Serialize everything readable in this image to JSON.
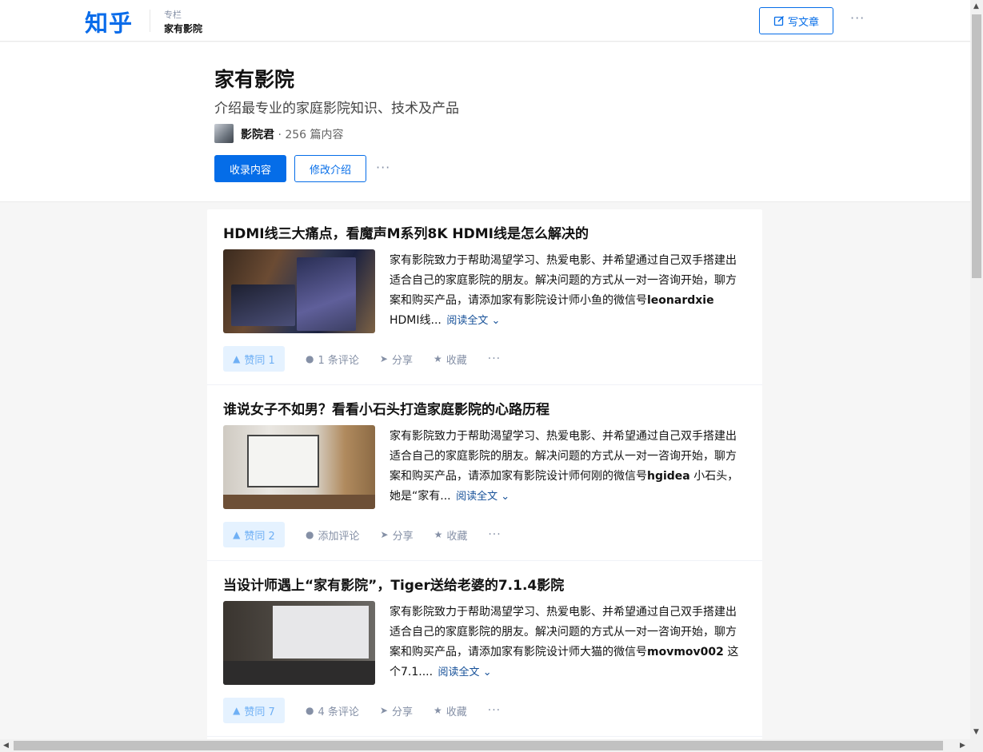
{
  "header": {
    "logo": "知乎",
    "crumb_small": "专栏",
    "crumb_title": "家有影院",
    "write_label": "写文章",
    "more": "···"
  },
  "column": {
    "title": "家有影院",
    "description": "介绍最专业的家庭影院知识、技术及产品",
    "author": "影院君",
    "count_text": " · 256 篇内容",
    "collect_label": "收录内容",
    "edit_label": "修改介绍",
    "more": "···"
  },
  "articles": [
    {
      "title": "HDMI线三大痛点，看魔声M系列8K HDMI线是怎么解决的",
      "excerpt": "家有影院致力于帮助渴望学习、热爱电影、并希望通过自己双手搭建出适合自己的家庭影院的朋友。解决问题的方式从一对一咨询开始，聊方案和购买产品，请添加家有影院设计师小鱼的微信号",
      "bold": "leonardxie",
      "tail": " HDMI线...",
      "read_more": "阅读全文",
      "vote": "赞同 1",
      "comment": "1 条评论",
      "share": "分享",
      "favorite": "收藏",
      "more": "···"
    },
    {
      "title": "谁说女子不如男？看看小石头打造家庭影院的心路历程",
      "excerpt": "家有影院致力于帮助渴望学习、热爱电影、并希望通过自己双手搭建出适合自己的家庭影院的朋友。解决问题的方式从一对一咨询开始，聊方案和购买产品，请添加家有影院设计师何刚的微信号",
      "bold": "hgidea",
      "tail": " 小石头，她是“家有...",
      "read_more": "阅读全文",
      "vote": "赞同 2",
      "comment": "添加评论",
      "share": "分享",
      "favorite": "收藏",
      "more": "···"
    },
    {
      "title": "当设计师遇上“家有影院”，Tiger送给老婆的7.1.4影院",
      "excerpt": "家有影院致力于帮助渴望学习、热爱电影、并希望通过自己双手搭建出适合自己的家庭影院的朋友。解决问题的方式从一对一咨询开始，聊方案和购买产品，请添加家有影院设计师大猫的微信号",
      "bold": "movmov002",
      "tail": " 这个7.1....",
      "read_more": "阅读全文",
      "vote": "赞同 7",
      "comment": "4 条评论",
      "share": "分享",
      "favorite": "收藏",
      "more": "···"
    }
  ],
  "colors": {
    "brand": "#056de8",
    "vote_bg": "#e5f2ff",
    "muted": "#8590a6"
  }
}
